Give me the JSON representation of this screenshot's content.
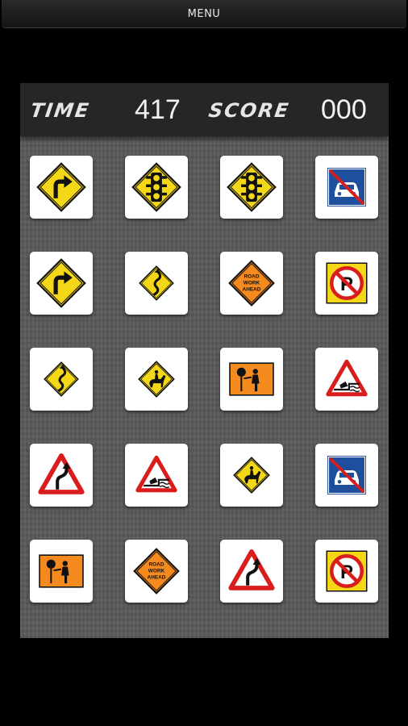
{
  "menu": {
    "label": "MENU"
  },
  "hud": {
    "time_label": "TIME",
    "time_value": "417",
    "score_label": "SCORE",
    "score_value": "000"
  },
  "tiles": [
    [
      "right-turn-sign",
      "traffic-signal-sign",
      "traffic-signal-sign",
      "no-cars-sign"
    ],
    [
      "right-turn-sign",
      "winding-road-sign",
      "road-work-ahead-sign",
      "no-parking-sign"
    ],
    [
      "winding-road-sign",
      "horse-rider-sign",
      "flagger-sign",
      "quayside-sign"
    ],
    [
      "double-bend-sign",
      "quayside-sign",
      "horse-rider-sign",
      "no-cars-sign"
    ],
    [
      "flagger-sign",
      "road-work-ahead-sign",
      "double-bend-sign",
      "no-parking-sign"
    ]
  ],
  "sign_text": {
    "road_work_ahead": [
      "ROAD",
      "WORK",
      "AHEAD"
    ]
  },
  "colors": {
    "warning_yellow": "#f4d716",
    "work_orange": "#f58a1f",
    "regulatory_red": "#d91c1c",
    "info_blue": "#1d4f9c"
  }
}
